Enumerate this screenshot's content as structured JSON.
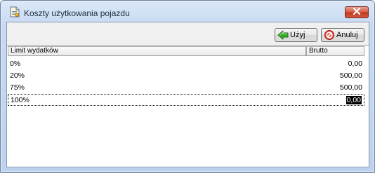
{
  "window": {
    "title": "Koszty użytkowania pojazdu",
    "icon": "document-icon",
    "close_icon": "close-icon"
  },
  "toolbar": {
    "use_label": "Użyj",
    "use_icon": "green-arrow-left-icon",
    "cancel_label": "Anuluj",
    "cancel_icon": "red-cancel-icon"
  },
  "table": {
    "columns": [
      "Limit wydatków",
      "Brutto"
    ],
    "rows": [
      {
        "limit": "0%",
        "brutto": "0,00"
      },
      {
        "limit": "20%",
        "brutto": "500,00"
      },
      {
        "limit": "75%",
        "brutto": "500,00"
      },
      {
        "limit": "100%",
        "brutto": "0,00"
      }
    ],
    "selected_row_index": 3
  }
}
